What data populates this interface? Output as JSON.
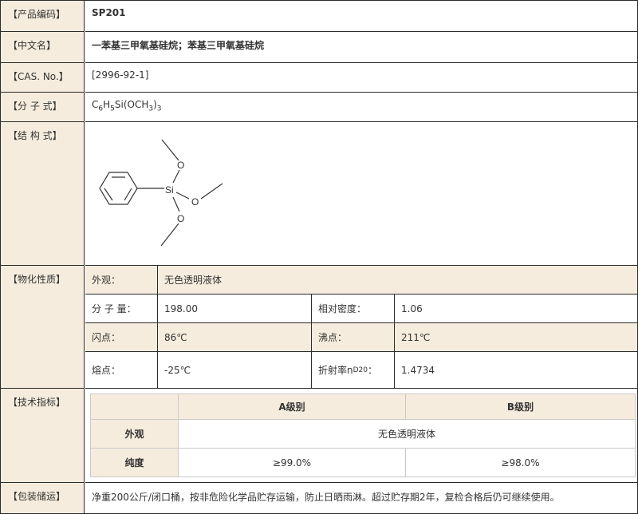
{
  "rows": {
    "code": {
      "label": "【产品编码】",
      "value": "SP201"
    },
    "cn_name": {
      "label": "【中文名】",
      "value": "一苯基三甲氧基硅烷；苯基三甲氧基硅烷"
    },
    "cas": {
      "label": "【CAS. No.】",
      "value": "[2996-92-1]"
    },
    "formula": {
      "label": "【分 子 式】",
      "parts": [
        "C",
        "6",
        "H",
        "5",
        "Si(OCH",
        "3",
        ")",
        "3"
      ]
    },
    "structure": {
      "label": "【结 构 式】",
      "atoms": {
        "si": "Si",
        "o": "O"
      }
    },
    "props": {
      "label": "【物化性质】",
      "appearance_label": "外观：",
      "appearance_value": "无色透明液体",
      "mw_label": "分 子 量：",
      "mw_value": "198.00",
      "density_label": "相对密度：",
      "density_value": "1.06",
      "flash_label": "闪点：",
      "flash_value": "86℃",
      "boil_label": "沸点：",
      "boil_value": "211℃",
      "melt_label": "熔点：",
      "melt_value": "-25℃",
      "ri_label_pre": "折射率n",
      "ri_sub": "D",
      "ri_sup": "20",
      "ri_label_post": "：",
      "ri_value": "1.4734"
    },
    "spec": {
      "label": "【技术指标】",
      "col_a": "A级别",
      "col_b": "B级别",
      "row1_label": "外观",
      "row1_value": "无色透明液体",
      "row2_label": "纯度",
      "row2_a": "≥99.0%",
      "row2_b": "≥98.0%"
    },
    "package": {
      "label": "【包装储运】",
      "value": "净重200公斤/闭口桶，按非危险化学品贮存运输，防止日晒雨淋。超过贮存期2年，复检合格后仍可继续使用。"
    }
  },
  "colors": {
    "label_bg": "#f6ecdd",
    "border": "#2b2b2b",
    "inner_border": "#c9c9c9"
  }
}
